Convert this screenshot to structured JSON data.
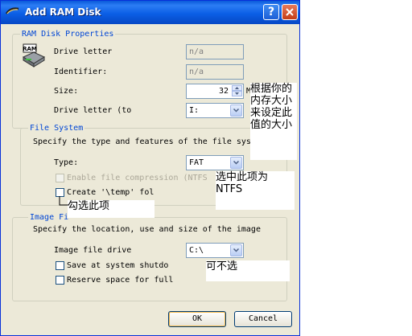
{
  "window": {
    "title": "Add RAM Disk",
    "help_glyph": "?",
    "close_glyph": "✕",
    "app_icon": "ram-icon"
  },
  "ram_group": {
    "title": "RAM Disk Properties",
    "icon_text": "RAM",
    "drive_letter_label": "Drive letter",
    "drive_letter_value": "n/a",
    "identifier_label": "Identifier:",
    "identifier_value": "n/a",
    "size_label": "Size:",
    "size_value": "32",
    "size_unit": "M",
    "drive_letter_to_label": "Drive letter (to",
    "drive_letter_to_value": "I:"
  },
  "fs_group": {
    "title": "File System",
    "description": "Specify the type and features of the file sys",
    "type_label": "Type:",
    "type_value": "FAT",
    "compression_label": "Enable file compression (NTFS",
    "temp_label": "Create '\\temp' fol"
  },
  "image_group": {
    "title": "Image Fi",
    "description": "Specify the location, use and size of the image",
    "drive_label": "Image file drive",
    "drive_value": "C:\\",
    "save_label": "Save at system shutdo",
    "reserve_label": "Reserve space for full"
  },
  "buttons": {
    "ok": "OK",
    "cancel": "Cancel"
  },
  "annotations": {
    "size_note": "根据你的内存大小来设定此值的大小",
    "ntfs_note": "选中此项为NTFS",
    "temp_note": "勾选此项",
    "optional_note": "可不选"
  }
}
